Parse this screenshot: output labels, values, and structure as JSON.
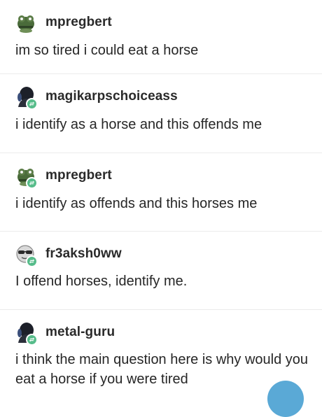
{
  "posts": [
    {
      "username": "mpregbert",
      "text": "im so tired i could eat a horse",
      "avatar_icon": "green-frog-avatar-icon",
      "reblogged": false
    },
    {
      "username": "magikarpschoiceass",
      "text": "i identify as a horse and this offends me",
      "avatar_icon": "dark-silhouette-avatar-icon",
      "reblogged": true
    },
    {
      "username": "mpregbert",
      "text": "i identify as offends and this horses me",
      "avatar_icon": "green-frog-avatar-icon",
      "reblogged": true
    },
    {
      "username": "fr3aksh0ww",
      "text": "I offend horses, identify me.",
      "avatar_icon": "sunglasses-face-avatar-icon",
      "reblogged": true
    },
    {
      "username": "metal-guru",
      "text": "i think the main question here is why would you eat a horse if you were tired",
      "avatar_icon": "dark-silhouette-avatar-icon",
      "reblogged": true
    }
  ],
  "colors": {
    "reblog_badge": "#56bc8a",
    "divider": "#ebebeb",
    "fab": "#5aa9d6"
  }
}
